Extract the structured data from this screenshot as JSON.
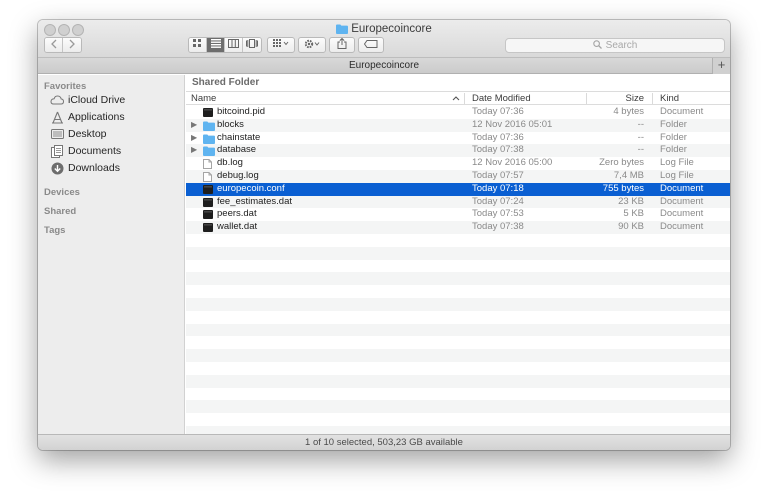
{
  "window": {
    "title": "Europecoincore"
  },
  "toolbar": {
    "back_icon": "chevron-left-icon",
    "forward_icon": "chevron-right-icon",
    "view_modes": [
      "icon-view-icon",
      "list-view-icon",
      "column-view-icon",
      "cover-flow-icon"
    ],
    "active_view": "list-view-icon",
    "search_placeholder": "Search"
  },
  "pathbar": {
    "title": "Europecoincore",
    "add_tab": "+"
  },
  "sidebar": {
    "favorites_label": "Favorites",
    "favorites": [
      {
        "label": "iCloud Drive",
        "icon": "cloud-icon"
      },
      {
        "label": "Applications",
        "icon": "applications-icon"
      },
      {
        "label": "Desktop",
        "icon": "desktop-icon"
      },
      {
        "label": "Documents",
        "icon": "documents-icon"
      },
      {
        "label": "Downloads",
        "icon": "downloads-icon"
      }
    ],
    "devices_label": "Devices",
    "shared_label": "Shared",
    "tags_label": "Tags"
  },
  "main": {
    "folder_title": "Shared Folder",
    "columns": {
      "name": "Name",
      "date": "Date Modified",
      "size": "Size",
      "kind": "Kind"
    },
    "files": [
      {
        "name": "bitcoind.pid",
        "date": "Today 07:36",
        "size": "4 bytes",
        "kind": "Document",
        "type": "exec",
        "expandable": false
      },
      {
        "name": "blocks",
        "date": "12 Nov 2016 05:01",
        "size": "--",
        "kind": "Folder",
        "type": "folder",
        "expandable": true
      },
      {
        "name": "chainstate",
        "date": "Today 07:36",
        "size": "--",
        "kind": "Folder",
        "type": "folder",
        "expandable": true
      },
      {
        "name": "database",
        "date": "Today 07:38",
        "size": "--",
        "kind": "Folder",
        "type": "folder",
        "expandable": true
      },
      {
        "name": "db.log",
        "date": "12 Nov 2016 05:00",
        "size": "Zero bytes",
        "kind": "Log File",
        "type": "doc",
        "expandable": false
      },
      {
        "name": "debug.log",
        "date": "Today 07:57",
        "size": "7,4 MB",
        "kind": "Log File",
        "type": "doc",
        "expandable": false
      },
      {
        "name": "europecoin.conf",
        "date": "Today 07:18",
        "size": "755 bytes",
        "kind": "Document",
        "type": "exec",
        "expandable": false,
        "selected": true
      },
      {
        "name": "fee_estimates.dat",
        "date": "Today 07:24",
        "size": "23 KB",
        "kind": "Document",
        "type": "exec",
        "expandable": false
      },
      {
        "name": "peers.dat",
        "date": "Today 07:53",
        "size": "5 KB",
        "kind": "Document",
        "type": "exec",
        "expandable": false
      },
      {
        "name": "wallet.dat",
        "date": "Today 07:38",
        "size": "90 KB",
        "kind": "Document",
        "type": "exec",
        "expandable": false
      }
    ],
    "empty_row_count": 16
  },
  "status": {
    "text": "1 of 10 selected, 503,23 GB available"
  },
  "colors": {
    "selection": "#0a5fd2",
    "folder": "#5fb4f0",
    "sidebar_bg": "#ededed"
  }
}
